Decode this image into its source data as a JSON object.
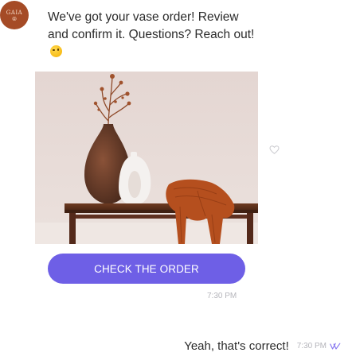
{
  "chat": {
    "brand": {
      "logo_text": "GAIA",
      "logo_mark": "⦾"
    },
    "bot_message": {
      "text": "We've got your vase order! Review and confirm it. Questions? Reach out!",
      "emoji": "winking-face"
    },
    "product_image": {
      "subject": "brown vase with dried branches, white ring vase, orange knit throw on wooden console table"
    },
    "button": {
      "label": "CHECK THE ORDER"
    },
    "bot_timestamp": "7:30 PM",
    "user_message": {
      "text": "Yeah, that's correct!",
      "timestamp": "7:30 PM",
      "status": "read"
    }
  },
  "colors": {
    "accent": "#6e5fe6",
    "avatar_bg": "#a54b26",
    "text": "#2b2b2b",
    "timestamp": "#b5b5bb",
    "read_receipt": "#8b7bf0"
  },
  "icons": {
    "like": "heart-outline-icon",
    "read_receipt": "double-check-icon",
    "emoji": "winking-face-icon"
  }
}
